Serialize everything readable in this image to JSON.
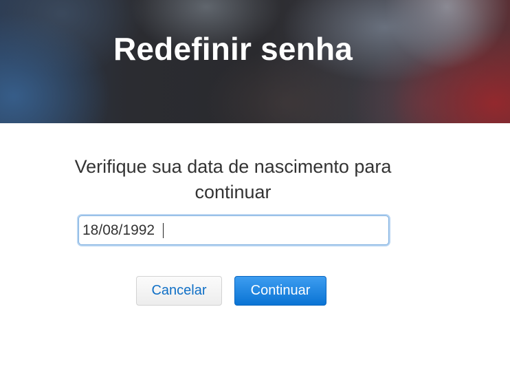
{
  "header": {
    "title": "Redefinir senha"
  },
  "form": {
    "prompt": "Verifique sua data de nascimento para continuar",
    "birthdate_value": "18/08/1992",
    "cancel_label": "Cancelar",
    "continue_label": "Continuar"
  },
  "colors": {
    "primary_button": "#1a82e0",
    "link_blue": "#0f6fc6",
    "text": "#333333",
    "focus_ring": "#b7d4f1"
  }
}
